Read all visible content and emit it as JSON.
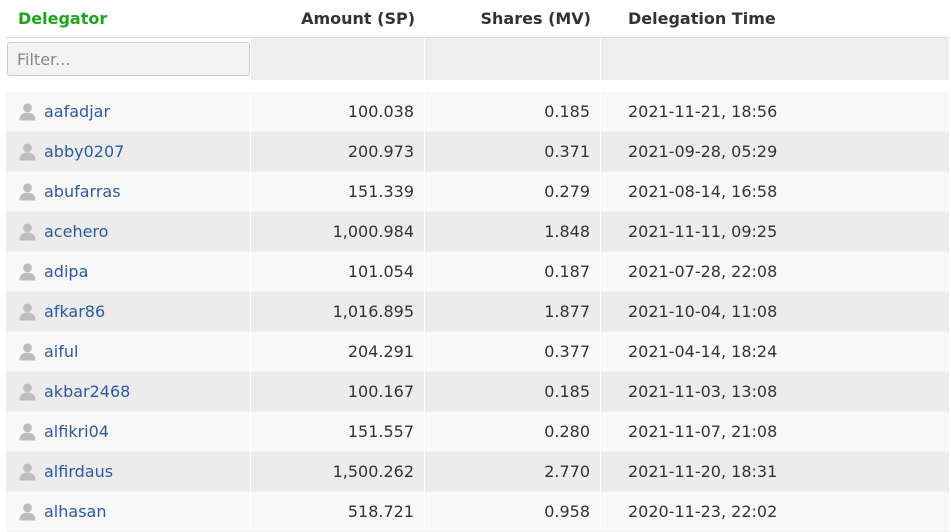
{
  "headers": {
    "delegator": "Delegator",
    "amount": "Amount (SP)",
    "shares": "Shares (MV)",
    "time": "Delegation Time"
  },
  "filter": {
    "placeholder": "Filter...",
    "value": ""
  },
  "colors": {
    "header_accent": "#1aa51a",
    "link": "#2a5aa5"
  },
  "icons": {
    "user": "user-icon"
  },
  "rows": [
    {
      "name": "aafadjar",
      "amount": "100.038",
      "shares": "0.185",
      "time": "2021-11-21, 18:56"
    },
    {
      "name": "abby0207",
      "amount": "200.973",
      "shares": "0.371",
      "time": "2021-09-28, 05:29"
    },
    {
      "name": "abufarras",
      "amount": "151.339",
      "shares": "0.279",
      "time": "2021-08-14, 16:58"
    },
    {
      "name": "acehero",
      "amount": "1,000.984",
      "shares": "1.848",
      "time": "2021-11-11, 09:25"
    },
    {
      "name": "adipa",
      "amount": "101.054",
      "shares": "0.187",
      "time": "2021-07-28, 22:08"
    },
    {
      "name": "afkar86",
      "amount": "1,016.895",
      "shares": "1.877",
      "time": "2021-10-04, 11:08"
    },
    {
      "name": "aiful",
      "amount": "204.291",
      "shares": "0.377",
      "time": "2021-04-14, 18:24"
    },
    {
      "name": "akbar2468",
      "amount": "100.167",
      "shares": "0.185",
      "time": "2021-11-03, 13:08"
    },
    {
      "name": "alfikri04",
      "amount": "151.557",
      "shares": "0.280",
      "time": "2021-11-07, 21:08"
    },
    {
      "name": "alfirdaus",
      "amount": "1,500.262",
      "shares": "2.770",
      "time": "2021-11-20, 18:31"
    },
    {
      "name": "alhasan",
      "amount": "518.721",
      "shares": "0.958",
      "time": "2020-11-23, 22:02"
    }
  ]
}
